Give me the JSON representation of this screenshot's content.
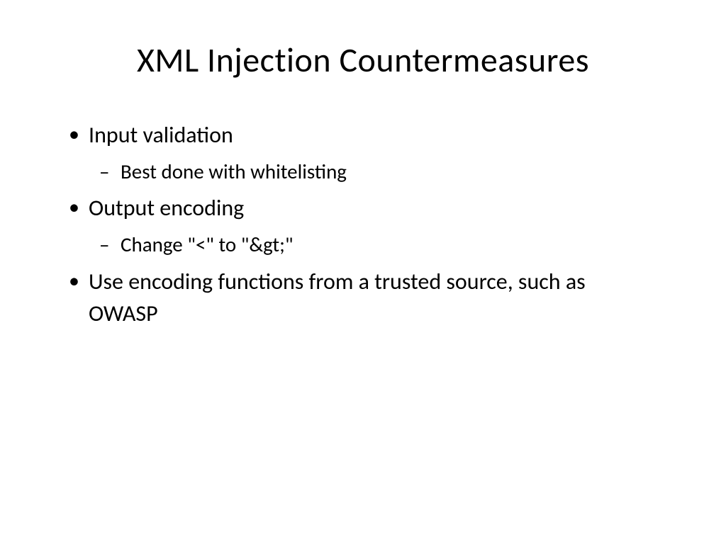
{
  "slide": {
    "title": "XML Injection Countermeasures",
    "bullets": [
      {
        "text": "Input validation",
        "sub": [
          {
            "text": "Best done with whitelisting"
          }
        ]
      },
      {
        "text": "Output encoding",
        "sub": [
          {
            "text": "Change \"<\" to \"&gt;\""
          }
        ]
      },
      {
        "text": "Use encoding functions from a trusted source, such as OWASP",
        "sub": []
      }
    ]
  }
}
